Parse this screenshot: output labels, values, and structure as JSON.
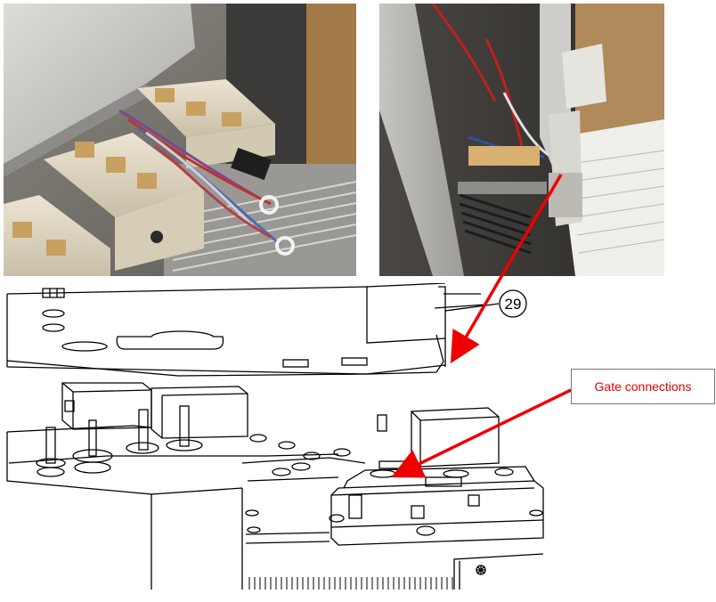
{
  "callouts": {
    "gate_connections": "Gate connections",
    "part_number": "29"
  },
  "colors": {
    "arrow": "#ee0000",
    "callout_text": "#e00000",
    "line": "#000000"
  },
  "images": [
    {
      "name": "photo-igbt-modules",
      "icon": "photo-icon"
    },
    {
      "name": "photo-bracket-side",
      "icon": "photo-icon"
    }
  ]
}
